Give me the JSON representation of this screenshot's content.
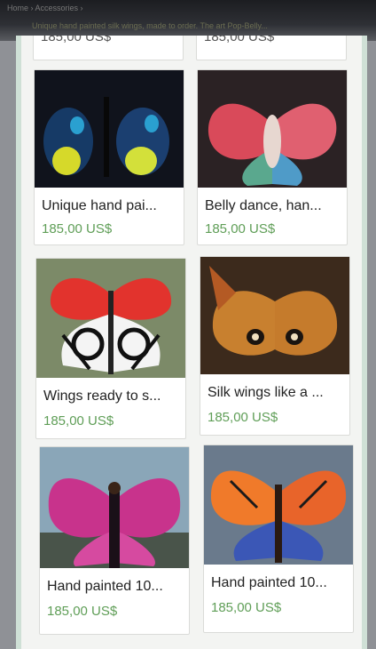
{
  "header": {
    "breadcrumb": "Home ›  Accessories ›",
    "subtitle": "Unique hand painted silk wings, made to order. The art Pop-Belly..."
  },
  "partial_price": "185,00 US$",
  "listings": [
    {
      "title": "Unique hand pai...",
      "price": "185,00 US$",
      "image": "black-blue-yellow-butterfly-wings"
    },
    {
      "title": "Belly dance, han...",
      "price": "185,00 US$",
      "image": "pink-red-belly-dance-wings"
    },
    {
      "title": "Wings ready to s...",
      "price": "185,00 US$",
      "image": "red-black-white-pattern-wings"
    },
    {
      "title": "Silk wings like a ...",
      "price": "185,00 US$",
      "image": "brown-moth-eye-wings"
    },
    {
      "title": "Hand painted 10...",
      "price": "185,00 US$",
      "image": "magenta-butterfly-wings"
    },
    {
      "title": "Hand painted 10...",
      "price": "185,00 US$",
      "image": "orange-blue-butterfly-wings"
    }
  ],
  "colors": {
    "price": "#5f9e57",
    "frame": "#cfe0d6"
  }
}
